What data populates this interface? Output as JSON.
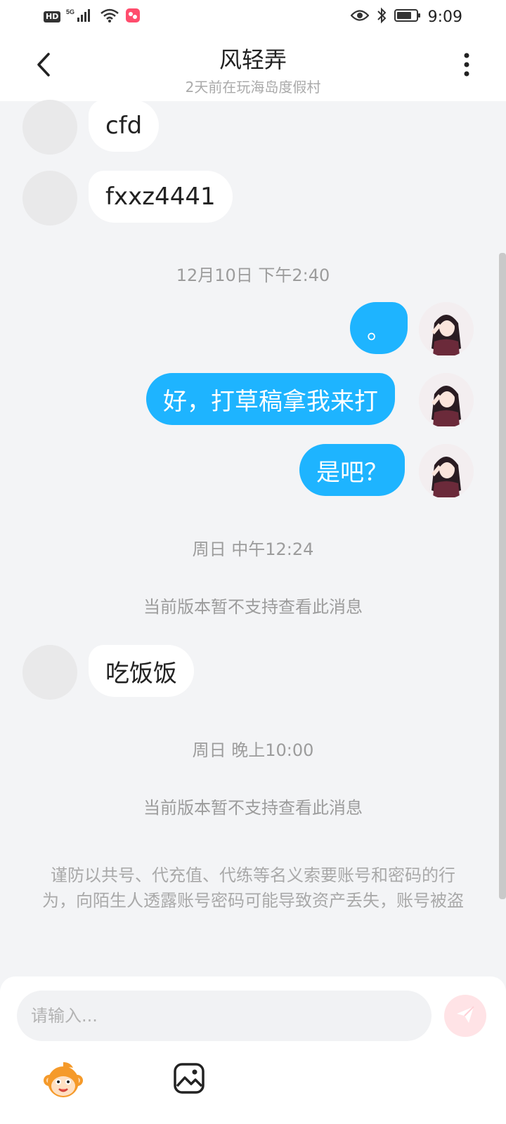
{
  "status_bar": {
    "hd": "HD",
    "network": "5G",
    "time": "9:09"
  },
  "header": {
    "title": "风轻弄",
    "subtitle": "2天前在玩海岛度假村"
  },
  "messages": {
    "m1": "cfd",
    "m2": "fxxz4441",
    "t1": "12月10日 下午2:40",
    "m3": "。",
    "m4": "好，打草稿拿我来打",
    "m5": "是吧？",
    "t2": "周日 中午12:24",
    "n1": "当前版本暂不支持查看此消息",
    "m6": "吃饭饭",
    "t3": "周日 晚上10:00",
    "n2": "当前版本暂不支持查看此消息"
  },
  "warning": {
    "text": "谨防以共号、代充值、代练等名义索要账号和密码的行为，向陌生人透露账号密码可能导致资产丢失，账号被盗"
  },
  "input": {
    "placeholder": "请输入..."
  },
  "colors": {
    "outgoing_bubble": "#1eb4ff",
    "background": "#f3f4f6",
    "send_button": "#ffe3e6"
  },
  "icons": {
    "back": "chevron-left-icon",
    "more": "more-vertical-icon",
    "send": "send-icon",
    "emoji": "monkey-emoji-icon",
    "image": "image-icon"
  }
}
